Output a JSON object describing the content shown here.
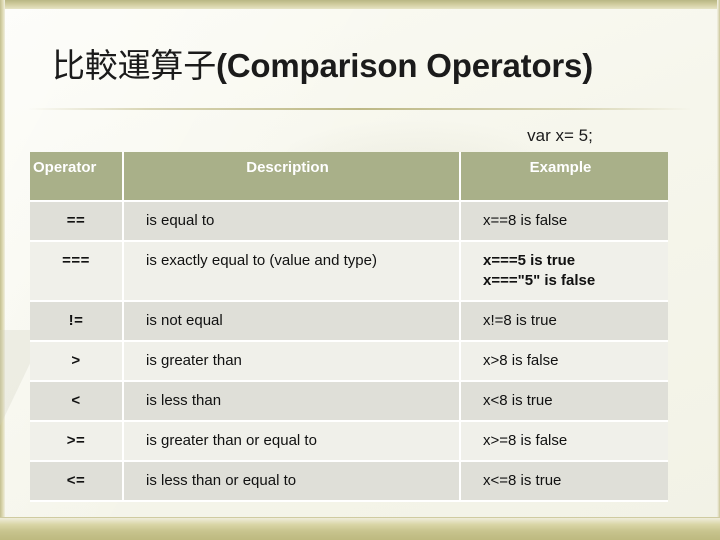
{
  "slide": {
    "title_cjk": "比較運算子",
    "title_latin": "(Comparison Operators)",
    "var_declaration": "var x= 5;",
    "accent_color": "#a9b089",
    "trim_color": "#c8c48e",
    "row_color": "#f0f0ea",
    "row_alt_color": "#dfdfd8"
  },
  "table": {
    "headers": {
      "operator": "Operator",
      "description": "Description",
      "example": "Example"
    },
    "rows": [
      {
        "operator": "==",
        "description": "is equal to",
        "example": "x==8 is false",
        "example_bold": false
      },
      {
        "operator": "===",
        "description": "is exactly equal to (value and type)",
        "example_line1": "x===5 is true",
        "example_line2": "x===\"5\" is false",
        "example_bold": true
      },
      {
        "operator": "!=",
        "description": "is not equal",
        "example": "x!=8 is true",
        "example_bold": false
      },
      {
        "operator": ">",
        "description": "is greater than",
        "example": "x>8 is false",
        "example_bold": false
      },
      {
        "operator": "<",
        "description": "is less than",
        "example": "x<8 is true",
        "example_bold": false
      },
      {
        "operator": ">=",
        "description": "is greater than or equal to",
        "example": "x>=8 is false",
        "example_bold": false
      },
      {
        "operator": "<=",
        "description": "is less than or equal to",
        "example": "x<=8 is true",
        "example_bold": false
      }
    ]
  }
}
